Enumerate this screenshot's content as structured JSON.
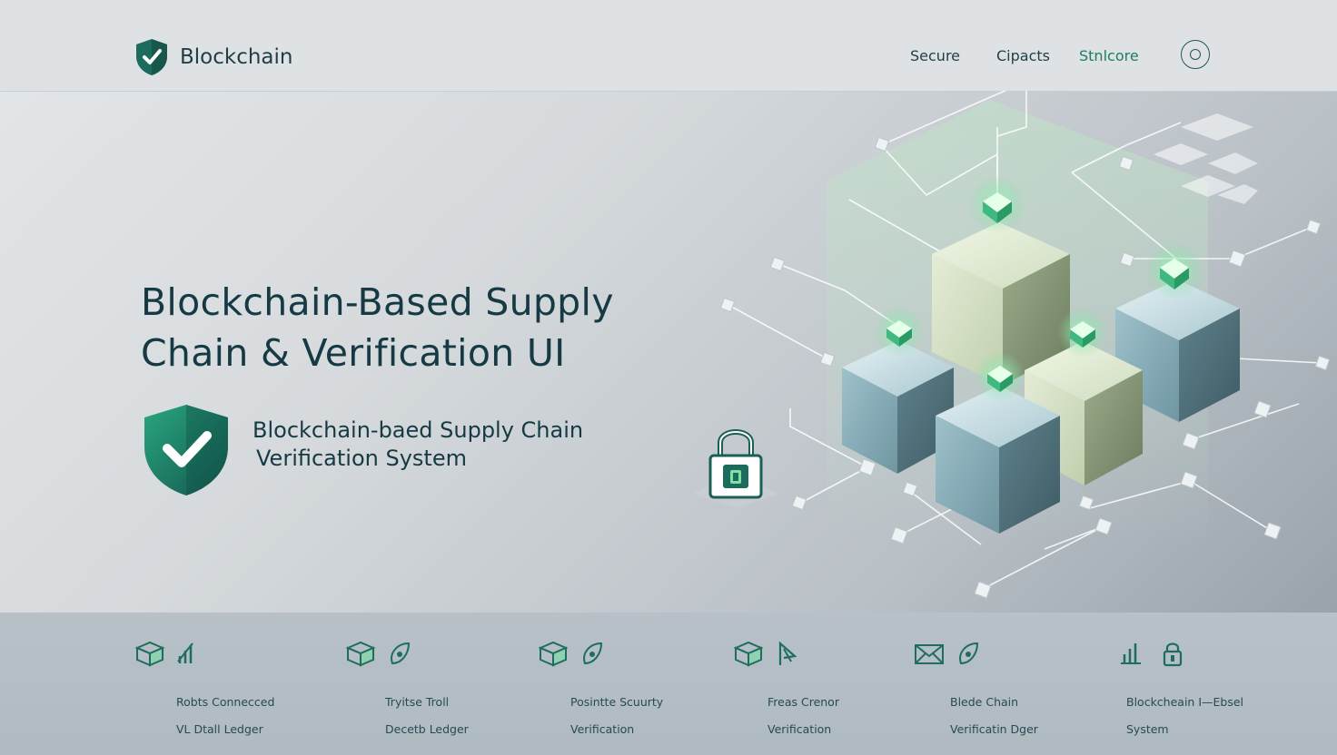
{
  "header": {
    "brand": "Blockchain",
    "nav": [
      "Secure",
      "Cipacts",
      "Stnlcore"
    ],
    "action_icon": "circle-icon"
  },
  "hero": {
    "title_line1": "Blockchain-Based Supply",
    "title_line2": "Chain & Verification UI",
    "badge_line1": "Blockchain-baed Supply Chain",
    "badge_line2": "Verification System"
  },
  "features": [
    {
      "icons": [
        "cube-icon",
        "chart-icon"
      ],
      "line1": "Robts Connecced",
      "line2": "VL Dtall Ledger"
    },
    {
      "icons": [
        "cube-icon",
        "leaf-icon"
      ],
      "line1": "Tryitse Troll",
      "line2": "Decetb Ledger"
    },
    {
      "icons": [
        "cube-icon",
        "leaf-icon"
      ],
      "line1": "Posintte Scuurty",
      "line2": "Verification"
    },
    {
      "icons": [
        "cube-icon",
        "flag-icon"
      ],
      "line1": "Freas Crenor",
      "line2": "Verification"
    },
    {
      "icons": [
        "envelope-icon",
        "leaf-icon"
      ],
      "line1": "Blede Chain",
      "line2": "Verificatin Dger"
    },
    {
      "icons": [
        "chart-icon",
        "lock-icon"
      ],
      "line1": "Blockcheain I—Ebsel",
      "line2": "System"
    }
  ],
  "colors": {
    "accent_green": "#1e8a6a",
    "dark_teal": "#163a44",
    "cube_blue": "#7fa3ad",
    "cube_green": "#cfdcc0",
    "glow": "#7fe0a4"
  }
}
